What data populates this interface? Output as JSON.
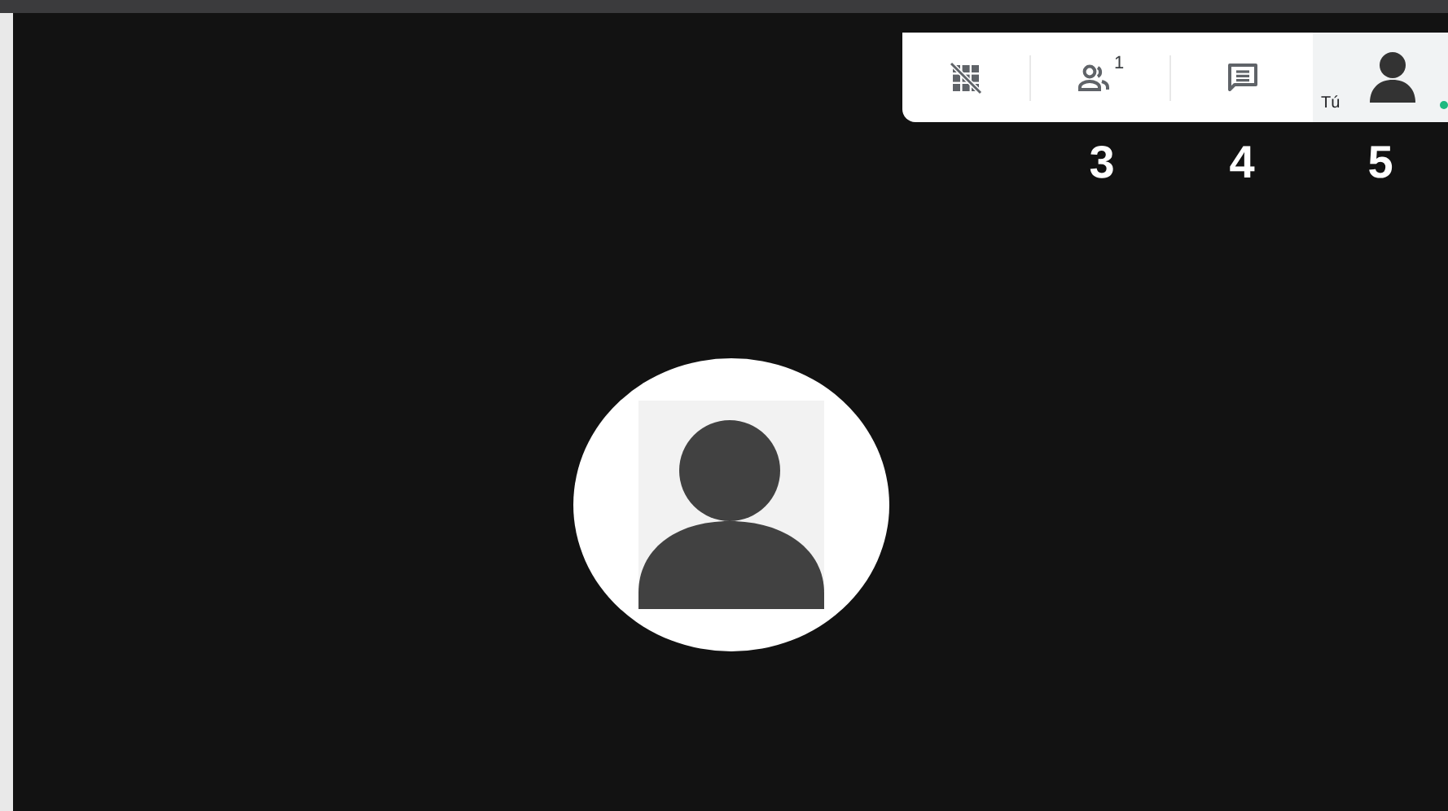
{
  "toolbar": {
    "buttons": [
      {
        "kind": "grid-off"
      },
      {
        "kind": "participants",
        "badge": "1"
      },
      {
        "kind": "chat"
      }
    ],
    "self_tile": {
      "label": "Tú",
      "online": true
    }
  },
  "callouts": [
    "3",
    "4",
    "5"
  ],
  "participant": {
    "kind": "avatar"
  }
}
